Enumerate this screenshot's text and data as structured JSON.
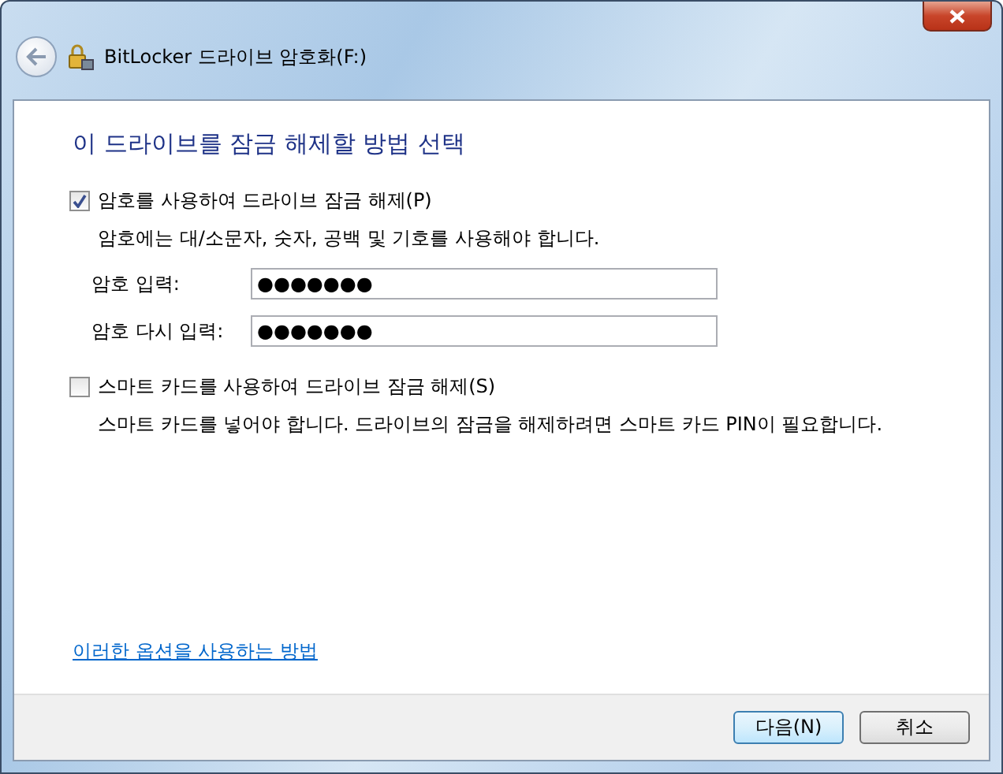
{
  "window": {
    "title": "BitLocker 드라이브 암호화(F:)"
  },
  "heading": "이 드라이브를 잠금 해제할 방법 선택",
  "options": [
    {
      "label": "암호를 사용하여 드라이브 잠금 해제(P)",
      "checked": true,
      "description": "암호에는 대/소문자, 숫자, 공백 및 기호를 사용해야 합니다.",
      "fields": [
        {
          "label": "암호 입력:",
          "value": "●●●●●●●"
        },
        {
          "label": "암호 다시 입력:",
          "value": "●●●●●●●"
        }
      ]
    },
    {
      "label": "스마트 카드를 사용하여 드라이브 잠금 해제(S)",
      "checked": false,
      "description": "스마트 카드를 넣어야 합니다. 드라이브의 잠금을 해제하려면 스마트 카드 PIN이 필요합니다."
    }
  ],
  "help_link": "이러한 옵션을 사용하는 방법",
  "buttons": [
    {
      "label": "다음(N)",
      "default": true
    },
    {
      "label": "취소",
      "default": false
    }
  ]
}
